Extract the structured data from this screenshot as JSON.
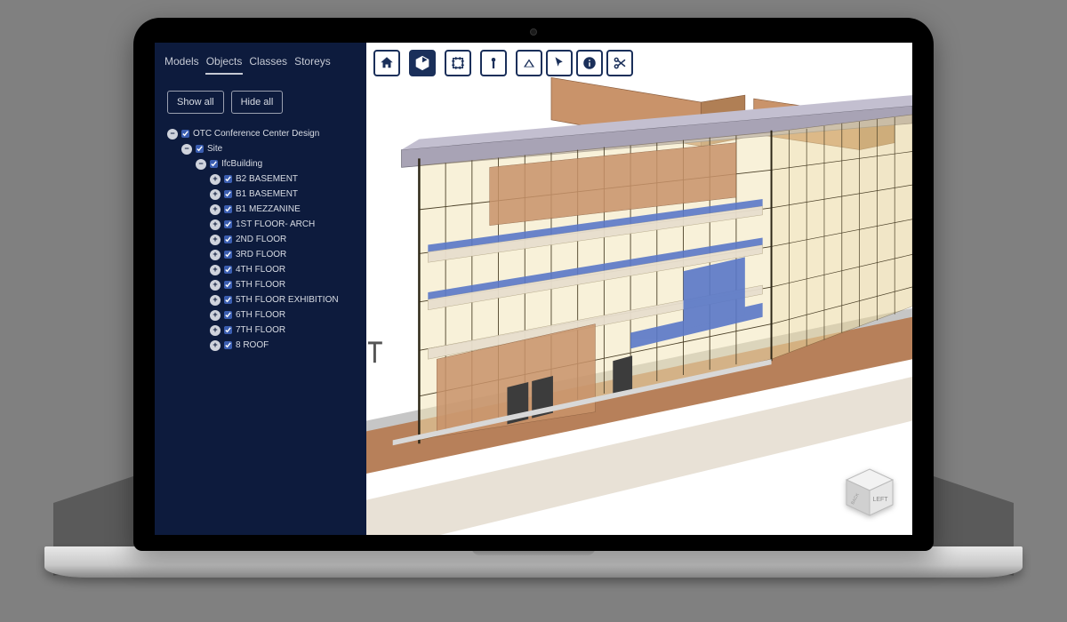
{
  "tabs": {
    "models": "Models",
    "objects": "Objects",
    "classes": "Classes",
    "storeys": "Storeys",
    "active": "objects"
  },
  "buttons": {
    "show_all": "Show all",
    "hide_all": "Hide all"
  },
  "tree": {
    "root": "OTC Conference Center Design",
    "site": "Site",
    "building": "IfcBuilding",
    "storeys": [
      "B2 BASEMENT",
      "B1 BASEMENT",
      "B1 MEZZANINE",
      "1ST FLOOR- ARCH",
      "2ND FLOOR",
      "3RD FLOOR",
      "4TH FLOOR",
      "5TH FLOOR",
      "5TH FLOOR EXHIBITION",
      "6TH FLOOR",
      "7TH FLOOR",
      "8 ROOF"
    ]
  },
  "toolbar": {
    "home": "home-icon",
    "cube": "cube-icon",
    "crop": "section-icon",
    "measure": "measure-icon",
    "hide": "hide-icon",
    "select": "select-icon",
    "info": "info-icon",
    "scissors": "scissors-icon"
  },
  "viewcube": {
    "front": "LEFT",
    "side": "BACK"
  },
  "colors": {
    "navy": "#0d1b3d",
    "wall": "#c9936a",
    "roof": "#a8a3b5",
    "glass": "#f2dfa8",
    "accent": "#5a78c8"
  }
}
